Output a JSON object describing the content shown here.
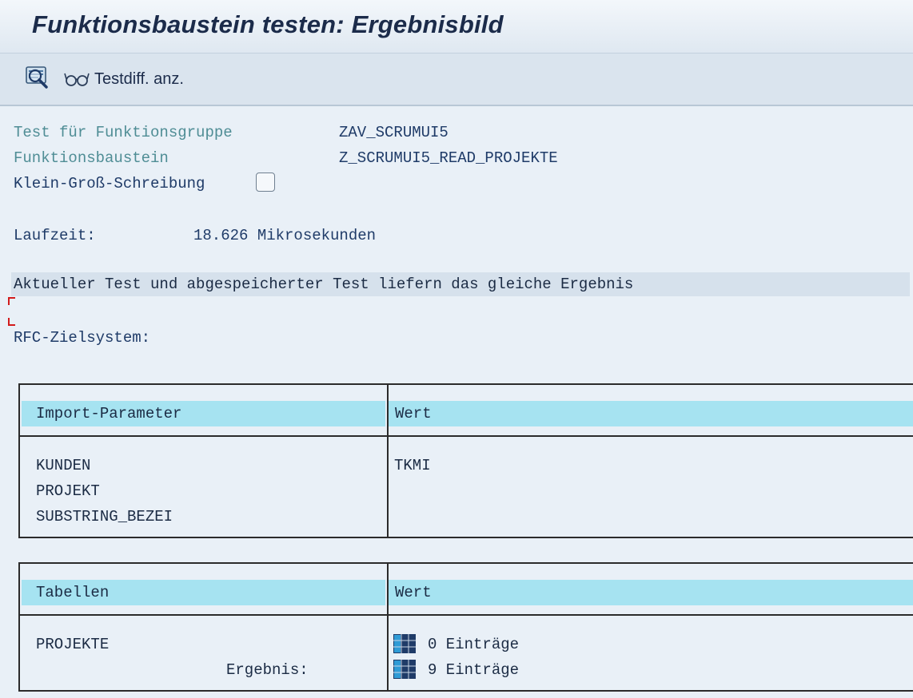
{
  "window": {
    "title": "Funktionsbaustein testen: Ergebnisbild"
  },
  "toolbar": {
    "execute_icon": "execute-magnifier-icon",
    "testdiff_icon": "glasses-icon",
    "testdiff_label": "Testdiff. anz."
  },
  "info": {
    "group_label": "Test für Funktionsgruppe",
    "group_value": "ZAV_SCRUMUI5",
    "module_label": "Funktionsbaustein",
    "module_value": "Z_SCRUMUI5_READ_PROJEKTE",
    "case_label": "Klein-Groß-Schreibung",
    "case_checked": false,
    "runtime_label": "Laufzeit:",
    "runtime_value": "18.626 Mikrosekunden",
    "compare_message": "Aktueller Test und abgespeicherter Test liefern das gleiche Ergebnis",
    "rfc_label": "RFC-Zielsystem:"
  },
  "import_table": {
    "col1_header": "Import-Parameter",
    "col2_header": "Wert",
    "rows": [
      {
        "name": "KUNDEN",
        "value": "TKMI"
      },
      {
        "name": "PROJEKT",
        "value": ""
      },
      {
        "name": "SUBSTRING_BEZEI",
        "value": ""
      }
    ]
  },
  "tables_table": {
    "col1_header": "Tabellen",
    "col2_header": "Wert",
    "row_name": "PROJEKTE",
    "result_label": "Ergebnis:",
    "entries_before": "0 Einträge",
    "entries_after": "9 Einträge",
    "entries_icon": "table-grid-icon"
  },
  "colors": {
    "background": "#e9f0f7",
    "header_cell": "#a6e3f1",
    "teal_text": "#4f8d95",
    "navy_text": "#1f3b68"
  }
}
